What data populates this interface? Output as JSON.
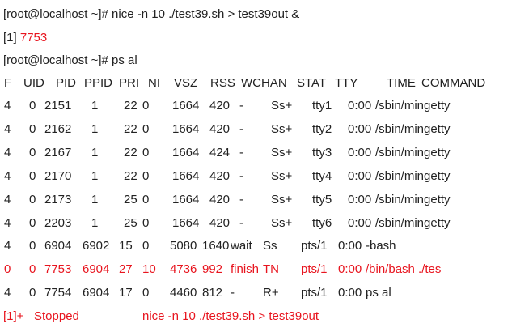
{
  "commands": {
    "line1": "[root@localhost ~]# nice -n 10 ./test39.sh > test39out &",
    "job_prefix": "[1] ",
    "job_pid": "7753",
    "line3": "[root@localhost ~]# ps al"
  },
  "ps_table": {
    "headers": [
      "F",
      "UID",
      "PID",
      "PPID",
      "PRI",
      "NI",
      "VSZ",
      "RSS",
      "WCHAN",
      "STAT",
      "TTY",
      "TIME",
      "COMMAND"
    ],
    "rows": [
      {
        "F": "4",
        "UID": "0",
        "PID": "2151",
        "PPID": "1",
        "PRI": "22",
        "NI": "0",
        "VSZ": "1664",
        "RSS": "420",
        "WCHAN": "-",
        "STAT": "Ss+",
        "TTY": "tty1",
        "TIME": "0:00",
        "COMMAND": "/sbin/mingetty",
        "highlight": false
      },
      {
        "F": "4",
        "UID": "0",
        "PID": "2162",
        "PPID": "1",
        "PRI": "22",
        "NI": "0",
        "VSZ": "1664",
        "RSS": "420",
        "WCHAN": "-",
        "STAT": "Ss+",
        "TTY": "tty2",
        "TIME": "0:00",
        "COMMAND": "/sbin/mingetty",
        "highlight": false
      },
      {
        "F": "4",
        "UID": "0",
        "PID": "2167",
        "PPID": "1",
        "PRI": "22",
        "NI": "0",
        "VSZ": "1664",
        "RSS": "424",
        "WCHAN": "-",
        "STAT": "Ss+",
        "TTY": "tty3",
        "TIME": "0:00",
        "COMMAND": "/sbin/mingetty",
        "highlight": false
      },
      {
        "F": "4",
        "UID": "0",
        "PID": "2170",
        "PPID": "1",
        "PRI": "22",
        "NI": "0",
        "VSZ": "1664",
        "RSS": "420",
        "WCHAN": "-",
        "STAT": "Ss+",
        "TTY": "tty4",
        "TIME": "0:00",
        "COMMAND": "/sbin/mingetty",
        "highlight": false
      },
      {
        "F": "4",
        "UID": "0",
        "PID": "2173",
        "PPID": "1",
        "PRI": "25",
        "NI": "0",
        "VSZ": "1664",
        "RSS": "420",
        "WCHAN": "-",
        "STAT": "Ss+",
        "TTY": "tty5",
        "TIME": "0:00",
        "COMMAND": "/sbin/mingetty",
        "highlight": false
      },
      {
        "F": "4",
        "UID": "0",
        "PID": "2203",
        "PPID": "1",
        "PRI": "25",
        "NI": "0",
        "VSZ": "1664",
        "RSS": "420",
        "WCHAN": "-",
        "STAT": "Ss+",
        "TTY": "tty6",
        "TIME": "0:00",
        "COMMAND": "/sbin/mingetty",
        "highlight": false
      },
      {
        "F": "4",
        "UID": "0",
        "PID": "6904",
        "PPID": "6902",
        "PRI": "15",
        "NI": "0",
        "VSZ": "5080",
        "RSS": "1640",
        "WCHAN": "wait",
        "STAT": "Ss",
        "TTY": "pts/1",
        "TIME": "0:00",
        "COMMAND": "-bash",
        "highlight": false
      },
      {
        "F": "0",
        "UID": "0",
        "PID": "7753",
        "PPID": "6904",
        "PRI": "27",
        "NI": "10",
        "VSZ": "4736",
        "RSS": "992",
        "WCHAN": "finish",
        "STAT": "TN",
        "TTY": "pts/1",
        "TIME": "0:00",
        "COMMAND": "/bin/bash ./tes",
        "highlight": true
      },
      {
        "F": "4",
        "UID": "0",
        "PID": "7754",
        "PPID": "6904",
        "PRI": "17",
        "NI": "0",
        "VSZ": "4460",
        "RSS": "812",
        "WCHAN": "-",
        "STAT": "R+",
        "TTY": "pts/1",
        "TIME": "0:00",
        "COMMAND": "ps al",
        "highlight": false
      }
    ]
  },
  "job_status": {
    "id": "[1]+",
    "state": "Stopped",
    "command": "nice -n 10 ./test39.sh > test39out"
  },
  "colors": {
    "text": "#222222",
    "highlight": "#e8141e",
    "background": "#ffffff"
  }
}
